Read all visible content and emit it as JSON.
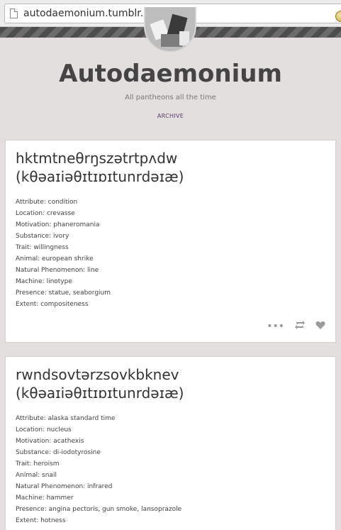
{
  "browser": {
    "url": "autodaemonium.tumblr.com"
  },
  "blog": {
    "title": "Autodaemonium",
    "description": "All pantheons all the time",
    "archive_label": "ARCHIVE"
  },
  "posts": [
    {
      "title_line1": "hktmtneθrŋszətrtpʌdw",
      "title_line2": "(kθəaɪiəθɪtɪɒɪtunrdəɪæ)",
      "attributes": [
        "Attribute: condition",
        "Location: crevasse",
        "Motivation: phaneromania",
        "Substance: ivory",
        "Trait: willingness",
        "Animal: european shrike",
        "Natural Phenomenon: line",
        "Machine: linotype",
        "Presence: statue, seaborgium",
        "Extent: compositeness"
      ]
    },
    {
      "title_line1": "rwndsovtərzsovkbknev",
      "title_line2": "(kθəaɪiəθɪtɪɒɪtunrdəɪæ)",
      "attributes": [
        "Attribute: alaska standard time",
        "Location: nucleus",
        "Motivation: acathexis",
        "Substance: di-iodotyrosine",
        "Trait: heroism",
        "Animal: snail",
        "Natural Phenomenon: infrared",
        "Machine: hammer",
        "Presence: angina pectoris, gun smoke, lansoprazole",
        "Extent: hotness"
      ]
    }
  ],
  "icons": {
    "more": "more-icon",
    "reblog": "reblog-icon",
    "like": "heart-icon"
  }
}
